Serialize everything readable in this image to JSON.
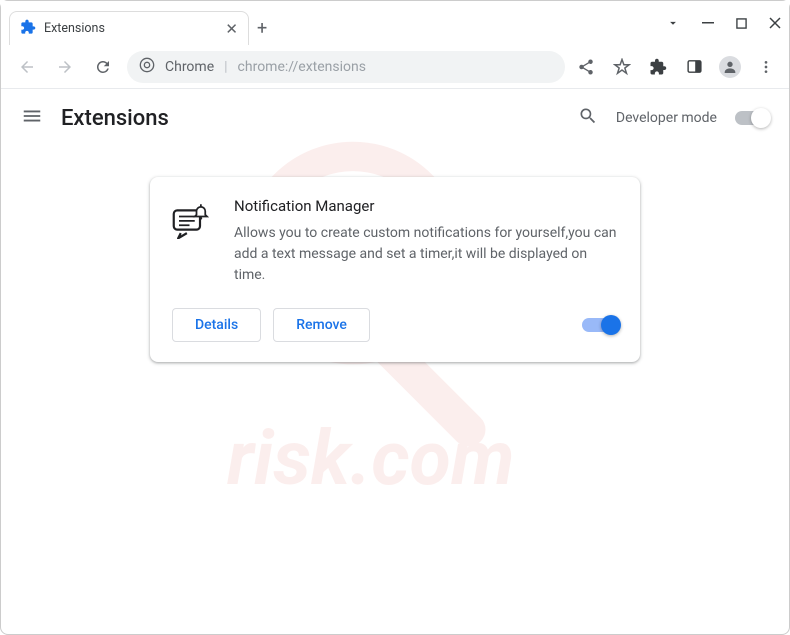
{
  "window": {
    "tab_title": "Extensions"
  },
  "addressbar": {
    "origin": "Chrome",
    "path": "chrome://extensions"
  },
  "page": {
    "title": "Extensions",
    "developer_mode_label": "Developer mode"
  },
  "extension": {
    "name": "Notification Manager",
    "description": "Allows you to create custom notifications for yourself,you can add a text message and set a timer,it will be displayed on time.",
    "details_label": "Details",
    "remove_label": "Remove",
    "enabled": true
  }
}
